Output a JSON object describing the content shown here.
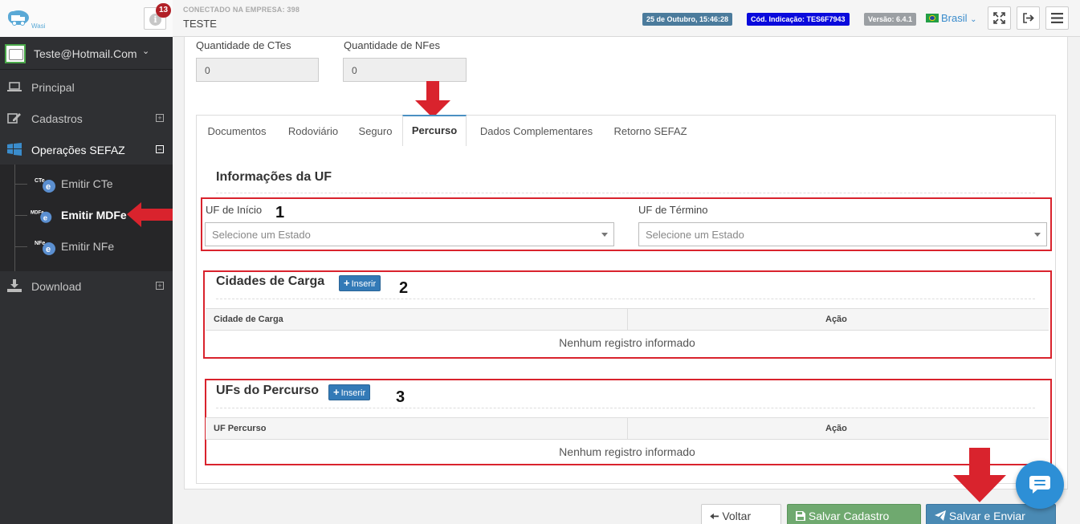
{
  "app": {
    "logo_text": "Wasi",
    "notifications_count": "13",
    "company_label": "CONECTADO NA EMPRESA: 398",
    "company_name": "TESTE",
    "date_badge": "25 de Outubro, 15:46:28",
    "code_badge": "Cód. Indicação: TES6F7943",
    "version_badge": "Versão: 6.4.1",
    "language": "Brasil",
    "icons": [
      "info-icon",
      "fullscreen-icon",
      "logout-icon",
      "menu-icon"
    ]
  },
  "sidebar": {
    "user": "Teste@Hotmail.Com",
    "items": [
      {
        "label": "Principal",
        "icon": "laptop-icon",
        "expandable": false
      },
      {
        "label": "Cadastros",
        "icon": "edit-icon",
        "expandable": true,
        "expand_symbol": "⊞"
      },
      {
        "label": "Operações SEFAZ",
        "icon": "windows-icon",
        "expandable": true,
        "expand_symbol": "⊟"
      },
      {
        "label": "Download",
        "icon": "download-icon",
        "expandable": true,
        "expand_symbol": "⊞"
      }
    ],
    "subitems": [
      {
        "label": "Emitir CTe",
        "tag": "CTe"
      },
      {
        "label": "Emitir MDFe",
        "tag": "MDFe",
        "active": true
      },
      {
        "label": "Emitir NFe",
        "tag": "NFe"
      }
    ]
  },
  "form": {
    "qtd_ctes_label": "Quantidade de CTes",
    "qtd_ctes_value": "0",
    "qtd_nfes_label": "Quantidade de NFes",
    "qtd_nfes_value": "0"
  },
  "tabs": [
    {
      "label": "Documentos"
    },
    {
      "label": "Rodoviário"
    },
    {
      "label": "Seguro"
    },
    {
      "label": "Percurso",
      "active": true
    },
    {
      "label": "Dados Complementares"
    },
    {
      "label": "Retorno SEFAZ"
    }
  ],
  "uf_section": {
    "title": "Informações da UF",
    "inicio_label": "UF de Início",
    "inicio_placeholder": "Selecione um Estado",
    "termino_label": "UF de Término",
    "termino_placeholder": "Selecione um Estado",
    "marker": "1"
  },
  "cidades_section": {
    "title": "Cidades de Carga",
    "insert_label": "Inserir",
    "col1": "Cidade de Carga",
    "col2": "Ação",
    "empty": "Nenhum registro informado",
    "marker": "2"
  },
  "ufs_section": {
    "title": "UFs do Percurso",
    "insert_label": "Inserir",
    "col1": "UF Percurso",
    "col2": "Ação",
    "empty": "Nenhum registro informado",
    "marker": "3"
  },
  "actions": {
    "voltar": "Voltar",
    "salvar": "Salvar Cadastro",
    "enviar": "Salvar e Enviar"
  },
  "colors": {
    "highlight": "#d9232d",
    "primary": "#337ab7",
    "success": "#6fa96f",
    "sidebar": "#2f3033"
  }
}
